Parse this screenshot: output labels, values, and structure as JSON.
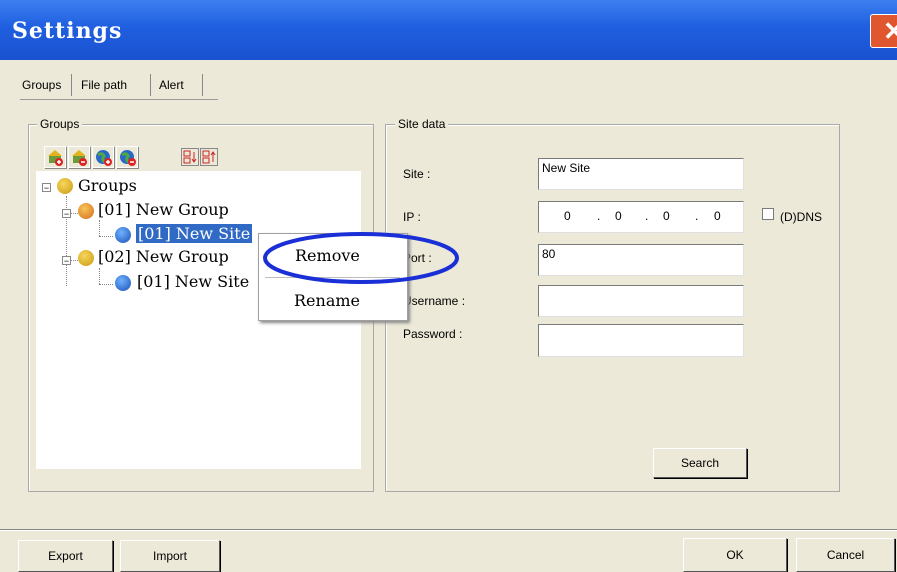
{
  "window": {
    "title": "Settings"
  },
  "tabs": [
    "Groups",
    "File path",
    "Alert"
  ],
  "groups_panel": {
    "legend": "Groups",
    "tree": {
      "root": "Groups",
      "groups": [
        {
          "label": "[01] New Group",
          "sites": [
            "[01] New Site"
          ]
        },
        {
          "label": "[02] New Group",
          "sites": [
            "[01] New Site"
          ]
        }
      ]
    }
  },
  "context_menu": {
    "items": [
      "Remove",
      "Rename"
    ]
  },
  "site_data": {
    "legend": "Site data",
    "site_label": "Site :",
    "site_value": "New Site",
    "ip_label": "IP :",
    "ip_octets": [
      "0",
      "0",
      "0",
      "0"
    ],
    "ddns_label": "(D)DNS",
    "port_label": "Port :",
    "port_value": "80",
    "username_label": "Username :",
    "username_value": "",
    "password_label": "Password :",
    "password_value": "",
    "search_label": "Search"
  },
  "footer": {
    "export_label": "Export",
    "import_label": "Import",
    "ok_label": "OK",
    "cancel_label": "Cancel"
  },
  "colors": {
    "titlebar": "#1f5fe0",
    "selection": "#316ac5",
    "highlight_ring": "#1a2fd6",
    "dialog_bg": "#ece9d8"
  }
}
